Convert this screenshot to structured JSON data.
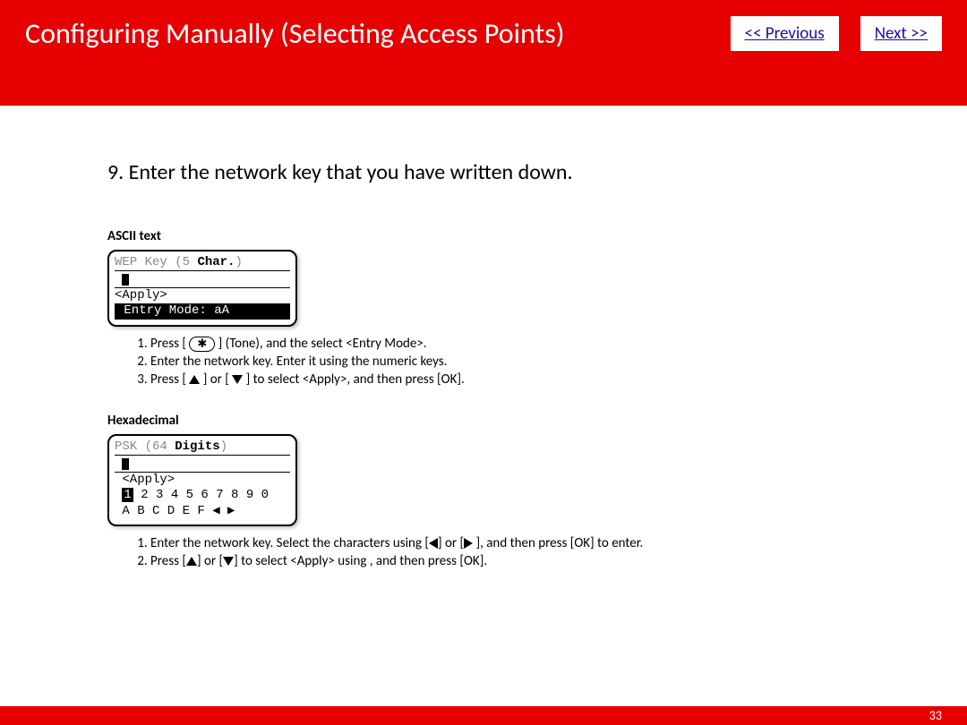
{
  "header": {
    "title": "Configuring Manually (Selecting Access Points)",
    "prev": "<< Previous",
    "next": "Next >>"
  },
  "step": {
    "num": "9.",
    "text": "Enter the network key that you have written down."
  },
  "ascii": {
    "label": "ASCII text",
    "lcd": {
      "l1a": "WEP Key ",
      "l1b": "(5 ",
      "l1c": "Char.",
      "l1d": ")",
      "l3": "<Apply>",
      "l4": " Entry Mode: aA"
    },
    "instr": {
      "i1a": "Press [ ",
      "i1b": " ] (Tone), and the select <Entry Mode>.",
      "i2": "Enter the network key. Enter it using the numeric keys.",
      "i3a": "Press [ ",
      "i3b": " ] or [ ",
      "i3c": " ] to select <Apply>, and then press [OK]."
    }
  },
  "hex": {
    "label": "Hexadecimal",
    "lcd": {
      "l1a": "PSK ",
      "l1b": "(64 ",
      "l1c": "Digits",
      "l1d": ")",
      "l3": " <Apply>",
      "l4sel": "1",
      "l4rest": " 2 3 4 5 6 7 8 9 0",
      "l5": " A B C D E F ◀ ▶"
    },
    "instr": {
      "i1a": "Enter the network key. Select the characters using [",
      "i1b": "] or [",
      "i1c": " ], and then press [OK] to enter.",
      "i2a": "Press [",
      "i2b": "] or [",
      "i2c": "] to select <Apply> using , and then press [OK]."
    }
  },
  "tone_star": "✱",
  "page_number": "33"
}
